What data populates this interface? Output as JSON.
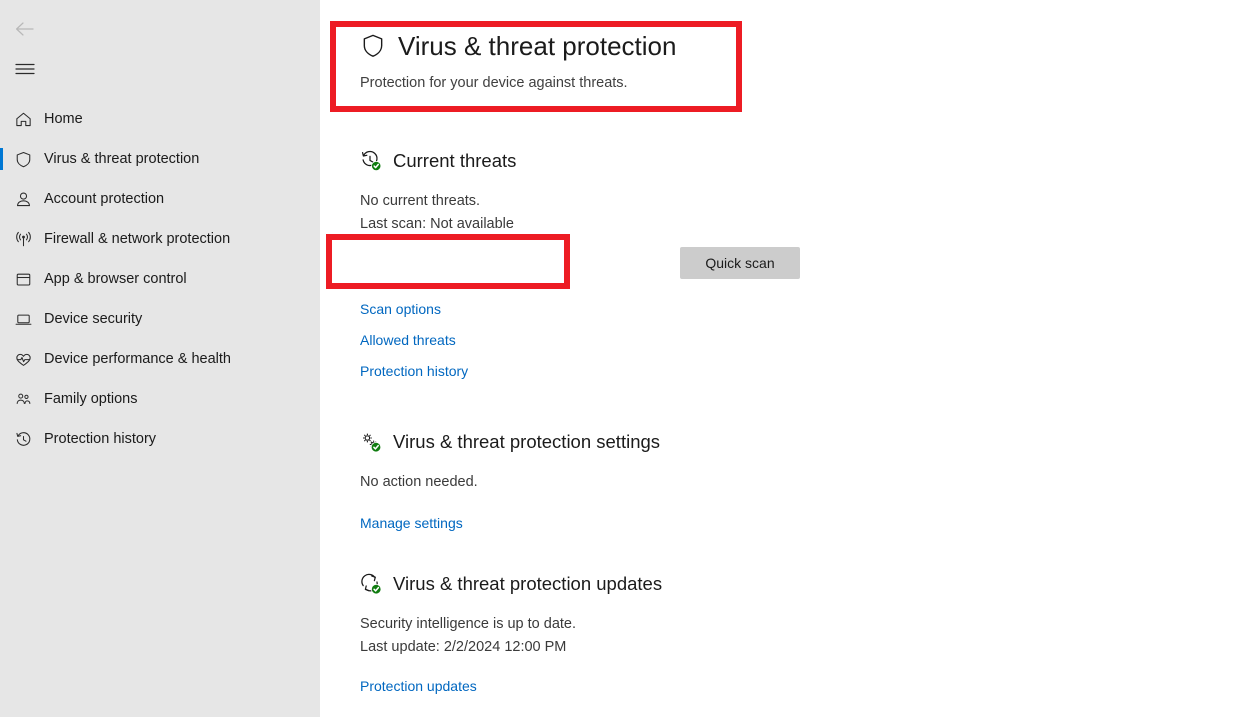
{
  "sidebar": {
    "back_icon": "back-arrow-icon",
    "menu_icon": "hamburger-menu-icon",
    "items": [
      {
        "label": "Home",
        "icon": "home-icon",
        "selected": false
      },
      {
        "label": "Virus & threat protection",
        "icon": "shield-icon",
        "selected": true
      },
      {
        "label": "Account protection",
        "icon": "person-icon",
        "selected": false
      },
      {
        "label": "Firewall & network protection",
        "icon": "wifi-signal-icon",
        "selected": false
      },
      {
        "label": "App & browser control",
        "icon": "window-app-icon",
        "selected": false
      },
      {
        "label": "Device security",
        "icon": "laptop-icon",
        "selected": false
      },
      {
        "label": "Device performance & health",
        "icon": "heart-pulse-icon",
        "selected": false
      },
      {
        "label": "Family options",
        "icon": "people-group-icon",
        "selected": false
      },
      {
        "label": "Protection history",
        "icon": "clock-history-icon",
        "selected": false
      }
    ],
    "accent_color": "#0078d4",
    "background_color": "#e6e6e6"
  },
  "header": {
    "icon": "shield-icon",
    "title": "Virus & threat protection",
    "subtitle": "Protection for your device against threats."
  },
  "current_threats": {
    "icon": "clock-check-icon",
    "title": "Current threats",
    "status": "No current threats.",
    "last_scan": "Last scan: Not available",
    "quick_scan_label": "Quick scan",
    "links": [
      {
        "label": "Scan options"
      },
      {
        "label": "Allowed threats"
      },
      {
        "label": "Protection history"
      }
    ]
  },
  "settings_section": {
    "icon": "gears-check-icon",
    "title": "Virus & threat protection settings",
    "status": "No action needed.",
    "link": "Manage settings"
  },
  "updates_section": {
    "icon": "refresh-check-icon",
    "title": "Virus & threat protection updates",
    "status": "Security intelligence is up to date.",
    "last_update": "Last update: 2/2/2024 12:00 PM",
    "link": "Protection updates"
  },
  "annotations": {
    "highlight_color": "#ed1c24",
    "boxes": [
      {
        "name": "header-highlight"
      },
      {
        "name": "quick-scan-highlight"
      }
    ]
  }
}
